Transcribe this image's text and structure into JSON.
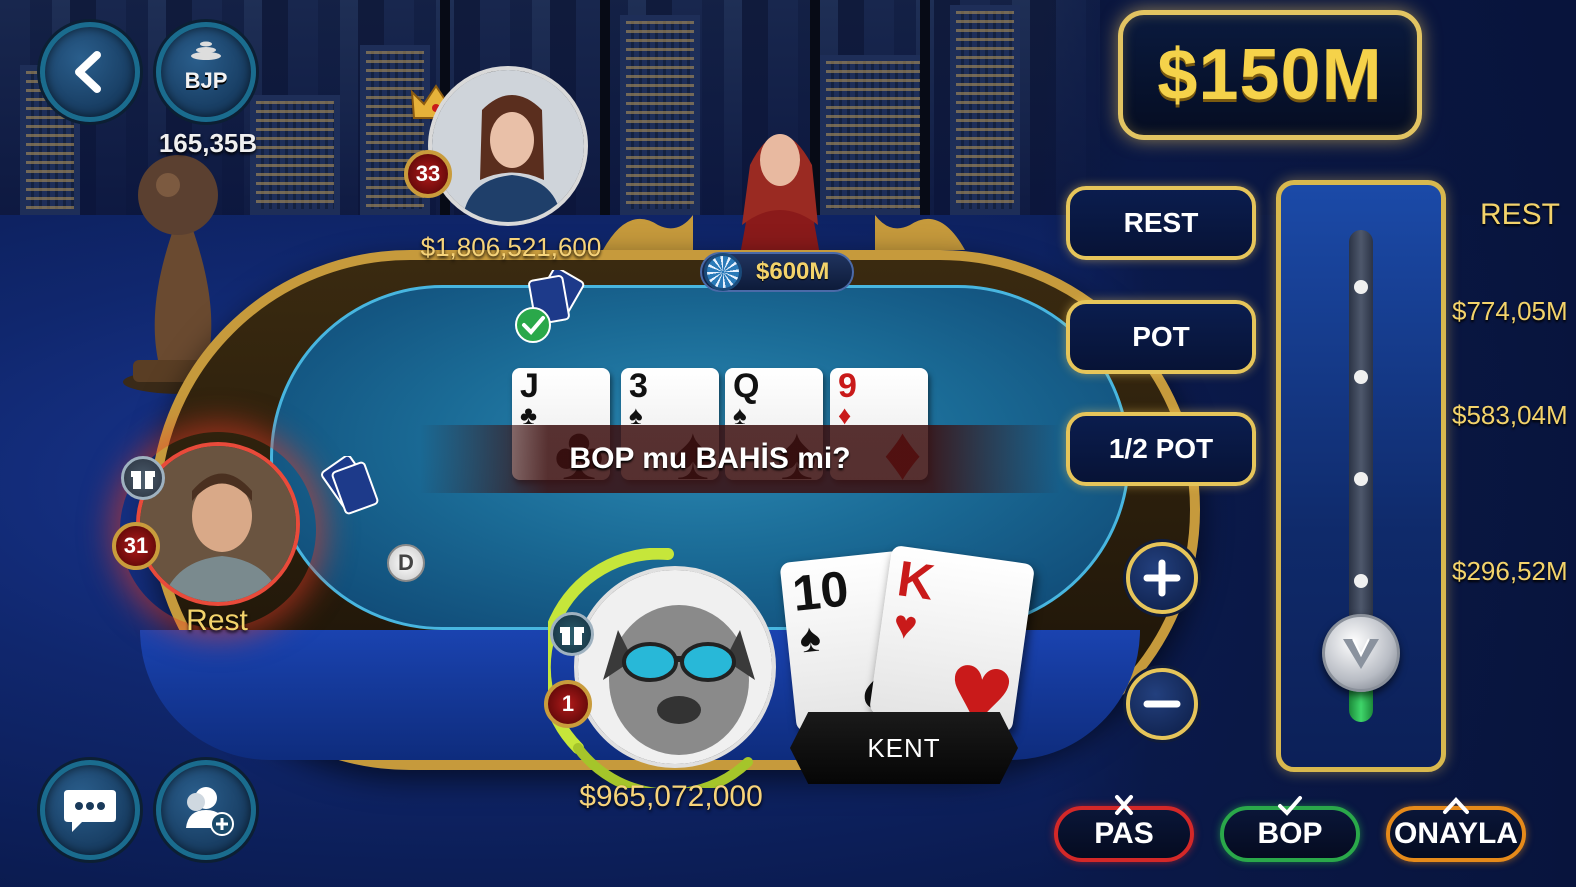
{
  "top_left": {
    "bjp_label": "BJP",
    "bjp_amount": "165,35B"
  },
  "players": {
    "top": {
      "level": "33",
      "money": "$1,806,521,600"
    },
    "left": {
      "level": "31",
      "status": "Rest"
    },
    "self": {
      "level": "1",
      "money": "$965,072,000"
    }
  },
  "table": {
    "pot": "$600M",
    "dealer_label": "D",
    "prompt": "BOP mu BAHİS mi?",
    "community_cards": [
      {
        "rank": "J",
        "suit": "♣",
        "color": "black"
      },
      {
        "rank": "3",
        "suit": "♠",
        "color": "black"
      },
      {
        "rank": "Q",
        "suit": "♠",
        "color": "black"
      },
      {
        "rank": "9",
        "suit": "♦",
        "color": "red"
      }
    ],
    "hole_cards": [
      {
        "rank": "10",
        "suit": "♠",
        "color": "black"
      },
      {
        "rank": "K",
        "suit": "♥",
        "color": "red"
      }
    ],
    "hand_name": "KENT"
  },
  "bet_panel": {
    "bet_amount": "$150M",
    "presets": [
      "REST",
      "POT",
      "1/2 POT"
    ],
    "slider_labels": [
      "REST",
      "$774,05M",
      "$583,04M",
      "$296,52M"
    ],
    "slider_level": 0.05
  },
  "actions": {
    "fold": "PAS",
    "check": "BOP",
    "confirm": "ONAYLA"
  },
  "colors": {
    "gold": "#e6c55a",
    "fold": "#d42828",
    "check": "#2aa84a",
    "confirm": "#e68a1a",
    "felt": "#1a6a95"
  },
  "icons": [
    "back-arrow-icon",
    "bjp-jackpot-icon",
    "chat-icon",
    "add-friend-icon",
    "gift-icon",
    "crown-icon",
    "check-mark-icon",
    "plus-icon",
    "minus-icon",
    "slider-logo-icon",
    "close-icon",
    "chevron-up-icon"
  ]
}
